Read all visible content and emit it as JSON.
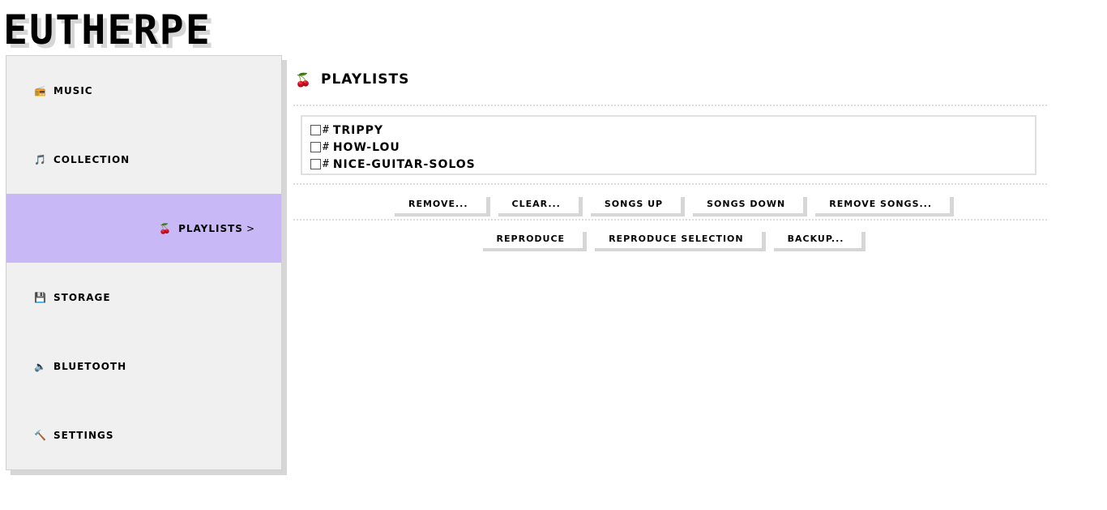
{
  "app": {
    "logo": "EUTHERPE"
  },
  "sidebar": {
    "items": [
      {
        "icon": "radio-icon",
        "glyph": "📻",
        "label": "MUSIC",
        "active": false
      },
      {
        "icon": "notes-icon",
        "glyph": "🎵",
        "label": "COLLECTION",
        "active": false
      },
      {
        "icon": "cherries-icon",
        "glyph": "🍒",
        "label": "PLAYLISTS",
        "active": true,
        "arrow": ">"
      },
      {
        "icon": "floppy-icon",
        "glyph": "💾",
        "label": "STORAGE",
        "active": false
      },
      {
        "icon": "speaker-icon",
        "glyph": "🔈",
        "label": "BLUETOOTH",
        "active": false
      },
      {
        "icon": "hammer-icon",
        "glyph": "🔨",
        "label": "SETTINGS",
        "active": false
      }
    ],
    "active_bg": "#c8b8f5"
  },
  "main": {
    "title_glyph": "🍒",
    "title": "PLAYLISTS",
    "playlists": [
      {
        "hash": "#",
        "name": "TRIPPY",
        "checked": false
      },
      {
        "hash": "#",
        "name": "HOW-LOU",
        "checked": false
      },
      {
        "hash": "#",
        "name": "NICE-GUITAR-SOLOS",
        "checked": false
      }
    ],
    "buttons_row1": [
      "REMOVE...",
      "CLEAR...",
      "SONGS UP",
      "SONGS DOWN",
      "REMOVE SONGS..."
    ],
    "buttons_row2": [
      "REPRODUCE",
      "REPRODUCE SELECTION",
      "BACKUP..."
    ]
  }
}
